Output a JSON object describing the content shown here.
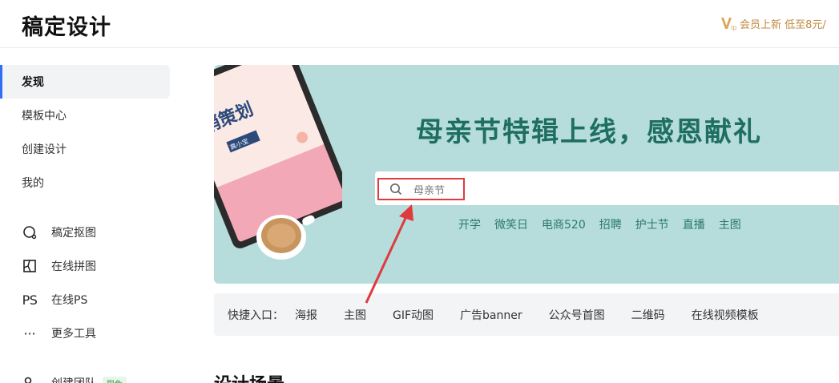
{
  "header": {
    "logo": "稿定设计",
    "vip_text": "会员上新 低至8元/",
    "vip_icon": "vip-icon"
  },
  "sidebar": {
    "items": [
      {
        "label": "发现",
        "active": true
      },
      {
        "label": "模板中心"
      },
      {
        "label": "创建设计"
      },
      {
        "label": "我的"
      }
    ],
    "tools": [
      {
        "label": "稿定抠图",
        "icon": "cutout-icon"
      },
      {
        "label": "在线拼图",
        "icon": "collage-icon"
      },
      {
        "label": "在线PS",
        "icon": "ps-icon",
        "icon_text": "PS"
      },
      {
        "label": "更多工具",
        "icon": "more-icon",
        "icon_text": "···"
      },
      {
        "label": "创建团队",
        "icon": "team-icon",
        "badge": "限免"
      }
    ]
  },
  "banner": {
    "title": "母亲节特辑上线，感恩献礼",
    "tablet_text": "销策划",
    "tablet_small": "高小宝",
    "search_placeholder": "母亲节",
    "hot_tags": [
      "开学",
      "微笑日",
      "电商520",
      "招聘",
      "护士节",
      "直播",
      "主图"
    ],
    "bg_color": "#b6dcdb"
  },
  "quick_entry": {
    "label": "快捷入口：",
    "links": [
      "海报",
      "主图",
      "GIF动图",
      "广告banner",
      "公众号首图",
      "二维码",
      "在线视频模板"
    ]
  },
  "section": {
    "title": "设计场景"
  },
  "colors": {
    "accent": "#2f6ef5",
    "highlight_border": "#e0393e",
    "banner_title": "#1e6e62",
    "vip": "#c08a3e"
  }
}
